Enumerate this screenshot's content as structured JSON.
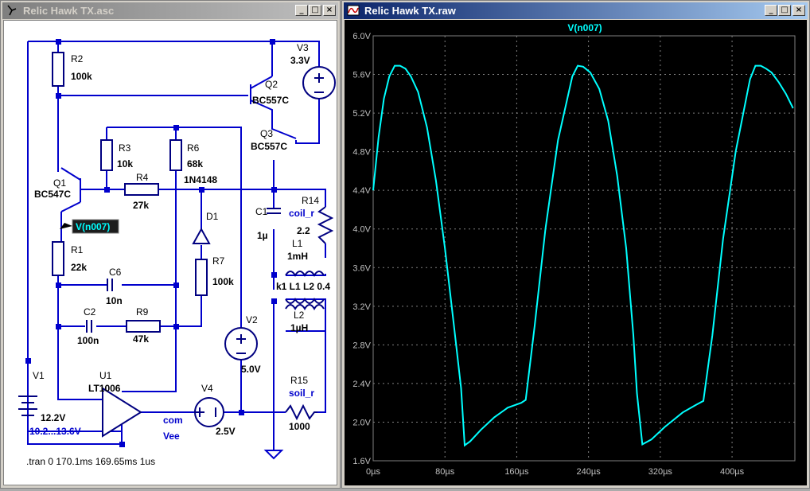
{
  "schematic_window": {
    "title": "Relic Hawk TX.asc",
    "buttons": {
      "minimize": "_",
      "maximize": "□",
      "close": "×"
    },
    "components": {
      "R2": {
        "name": "R2",
        "value": "100k"
      },
      "Q2": {
        "name": "Q2",
        "value": "BC557C"
      },
      "V3": {
        "name": "V3",
        "value": "3.3V"
      },
      "Q3": {
        "name": "Q3",
        "value": "BC557C"
      },
      "R3": {
        "name": "R3",
        "value": "10k"
      },
      "R6": {
        "name": "R6",
        "value": "68k"
      },
      "R4": {
        "name": "R4",
        "value": "27k"
      },
      "D1": {
        "name": "D1",
        "value": "1N4148"
      },
      "Q1": {
        "name": "Q1",
        "value": "BC547C"
      },
      "C1": {
        "name": "C1",
        "value": "1µ"
      },
      "R14": {
        "name": "R14",
        "value": "coil_r",
        "value2": "2.2"
      },
      "L1": {
        "name": "L1",
        "value": "1mH"
      },
      "K1": {
        "label": "k1 L1 L2 0.4"
      },
      "L2": {
        "name": "L2",
        "value": "1µH"
      },
      "R1": {
        "name": "R1",
        "value": "22k"
      },
      "C6": {
        "name": "C6",
        "value": "10n"
      },
      "R7": {
        "name": "R7",
        "value": "100k"
      },
      "C2": {
        "name": "C2",
        "value": "100n"
      },
      "R9": {
        "name": "R9",
        "value": "47k"
      },
      "V2": {
        "name": "V2",
        "value": "5.0V"
      },
      "V1": {
        "name": "V1",
        "value": "12.2V",
        "step": "10.2...13.6V"
      },
      "U1": {
        "name": "U1",
        "value": "LT1006"
      },
      "V4": {
        "name": "V4",
        "value": "2.5V"
      },
      "R15": {
        "name": "R15",
        "value": "soil_r",
        "value2": "1000"
      }
    },
    "net_labels": {
      "com": "com",
      "vee": "Vee"
    },
    "probe_label": "V(n007)",
    "directive": ".tran 0 170.1ms 169.65ms 1us"
  },
  "plot_window": {
    "title": "Relic Hawk TX.raw",
    "buttons": {
      "minimize": "_",
      "maximize": "□",
      "close": "×"
    },
    "trace_label": "V(n007)"
  },
  "colors": {
    "wire": "#0000cc",
    "trace": "#00ffff",
    "grid": "#808080",
    "plot_bg": "#000000"
  },
  "chart_data": {
    "type": "line",
    "title": "V(n007)",
    "xlabel": "",
    "ylabel": "",
    "x_unit": "µs",
    "y_unit": "V",
    "xlim": [
      0,
      470
    ],
    "ylim": [
      1.6,
      6.0
    ],
    "x_ticks": [
      0,
      80,
      160,
      240,
      320,
      400
    ],
    "x_tick_labels": [
      "0µs",
      "80µs",
      "160µs",
      "240µs",
      "320µs",
      "400µs"
    ],
    "y_ticks": [
      1.6,
      2.0,
      2.4,
      2.8,
      3.2,
      3.6,
      4.0,
      4.4,
      4.8,
      5.2,
      5.6,
      6.0
    ],
    "y_tick_labels": [
      "1.6V",
      "2.0V",
      "2.4V",
      "2.8V",
      "3.2V",
      "3.6V",
      "4.0V",
      "4.4V",
      "4.8V",
      "5.2V",
      "5.6V",
      "6.0V"
    ],
    "grid": true,
    "series": [
      {
        "name": "V(n007)",
        "color": "#00ffff",
        "x": [
          0,
          6,
          12,
          18,
          24,
          30,
          36,
          42,
          50,
          60,
          70,
          80,
          90,
          98,
          102,
          108,
          120,
          135,
          150,
          165,
          170,
          180,
          192,
          206,
          222,
          228,
          234,
          242,
          252,
          262,
          272,
          282,
          290,
          294,
          300,
          310,
          325,
          345,
          360,
          368,
          378,
          390,
          404,
          420,
          426,
          432,
          438,
          444,
          452,
          460,
          468
        ],
        "y": [
          4.4,
          4.95,
          5.35,
          5.58,
          5.69,
          5.69,
          5.66,
          5.58,
          5.42,
          5.05,
          4.5,
          3.8,
          3.0,
          2.35,
          1.76,
          1.8,
          1.92,
          2.05,
          2.15,
          2.2,
          2.23,
          3.0,
          4.0,
          4.92,
          5.58,
          5.69,
          5.68,
          5.62,
          5.45,
          5.12,
          4.55,
          3.8,
          2.9,
          2.3,
          1.77,
          1.82,
          1.95,
          2.1,
          2.18,
          2.22,
          2.9,
          3.9,
          4.8,
          5.55,
          5.69,
          5.69,
          5.66,
          5.62,
          5.52,
          5.4,
          5.25
        ]
      }
    ]
  }
}
